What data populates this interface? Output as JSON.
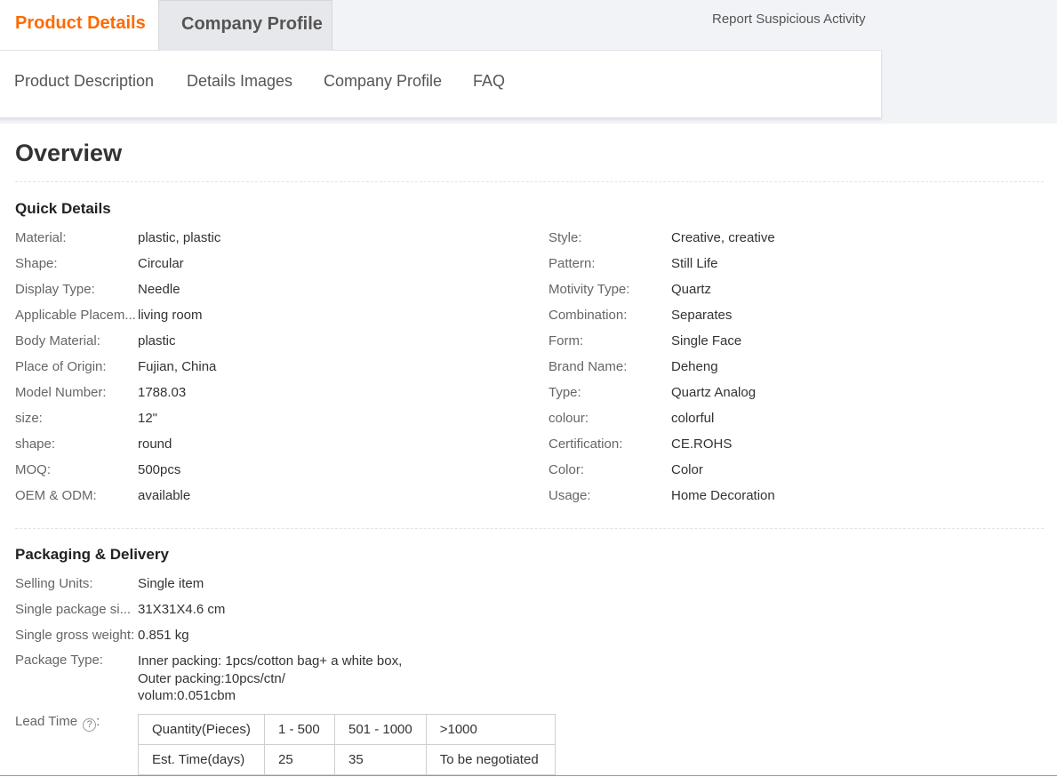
{
  "tabs": {
    "active": "Product Details",
    "inactive": "Company Profile"
  },
  "report_link": "Report Suspicious Activity",
  "subnav": [
    "Product Description",
    "Details Images",
    "Company Profile",
    "FAQ"
  ],
  "overview_title": "Overview",
  "quick_details": {
    "title": "Quick Details",
    "left": [
      {
        "key": "Material:",
        "value": "plastic, plastic"
      },
      {
        "key": "Shape:",
        "value": "Circular"
      },
      {
        "key": "Display Type:",
        "value": "Needle"
      },
      {
        "key": "Applicable Placem...",
        "value": "living room"
      },
      {
        "key": "Body Material:",
        "value": "plastic"
      },
      {
        "key": "Place of Origin:",
        "value": "Fujian, China"
      },
      {
        "key": "Model Number:",
        "value": "1788.03"
      },
      {
        "key": "size:",
        "value": "12\""
      },
      {
        "key": "shape:",
        "value": "round"
      },
      {
        "key": "MOQ:",
        "value": "500pcs"
      },
      {
        "key": "OEM & ODM:",
        "value": "available"
      }
    ],
    "right": [
      {
        "key": "Style:",
        "value": "Creative, creative"
      },
      {
        "key": "Pattern:",
        "value": "Still Life"
      },
      {
        "key": "Motivity Type:",
        "value": "Quartz"
      },
      {
        "key": "Combination:",
        "value": "Separates"
      },
      {
        "key": "Form:",
        "value": "Single Face"
      },
      {
        "key": "Brand Name:",
        "value": "Deheng"
      },
      {
        "key": "Type:",
        "value": "Quartz Analog"
      },
      {
        "key": "colour:",
        "value": "colorful"
      },
      {
        "key": "Certification:",
        "value": "CE.ROHS"
      },
      {
        "key": "Color:",
        "value": "Color"
      },
      {
        "key": "Usage:",
        "value": "Home Decoration"
      }
    ]
  },
  "packaging": {
    "title": "Packaging & Delivery",
    "rows": [
      {
        "key": "Selling Units:",
        "value": "Single item"
      },
      {
        "key": "Single package si...",
        "value": "31X31X4.6 cm"
      },
      {
        "key": "Single gross weight:",
        "value": "0.851 kg"
      }
    ],
    "package_type": {
      "key": "Package Type:",
      "lines": [
        "Inner packing: 1pcs/cotton bag+ a white box,",
        "Outer packing:10pcs/ctn/",
        "volum:0.051cbm"
      ]
    },
    "lead_time": {
      "label": "Lead Time",
      "help": "?",
      "table": [
        [
          "Quantity(Pieces)",
          "1 - 500",
          "501 - 1000",
          ">1000"
        ],
        [
          "Est. Time(days)",
          "25",
          "35",
          "To be negotiated"
        ]
      ]
    }
  },
  "colors": {
    "accent": "#ff6a00",
    "top_bar_bg": "#f2f3f7"
  }
}
